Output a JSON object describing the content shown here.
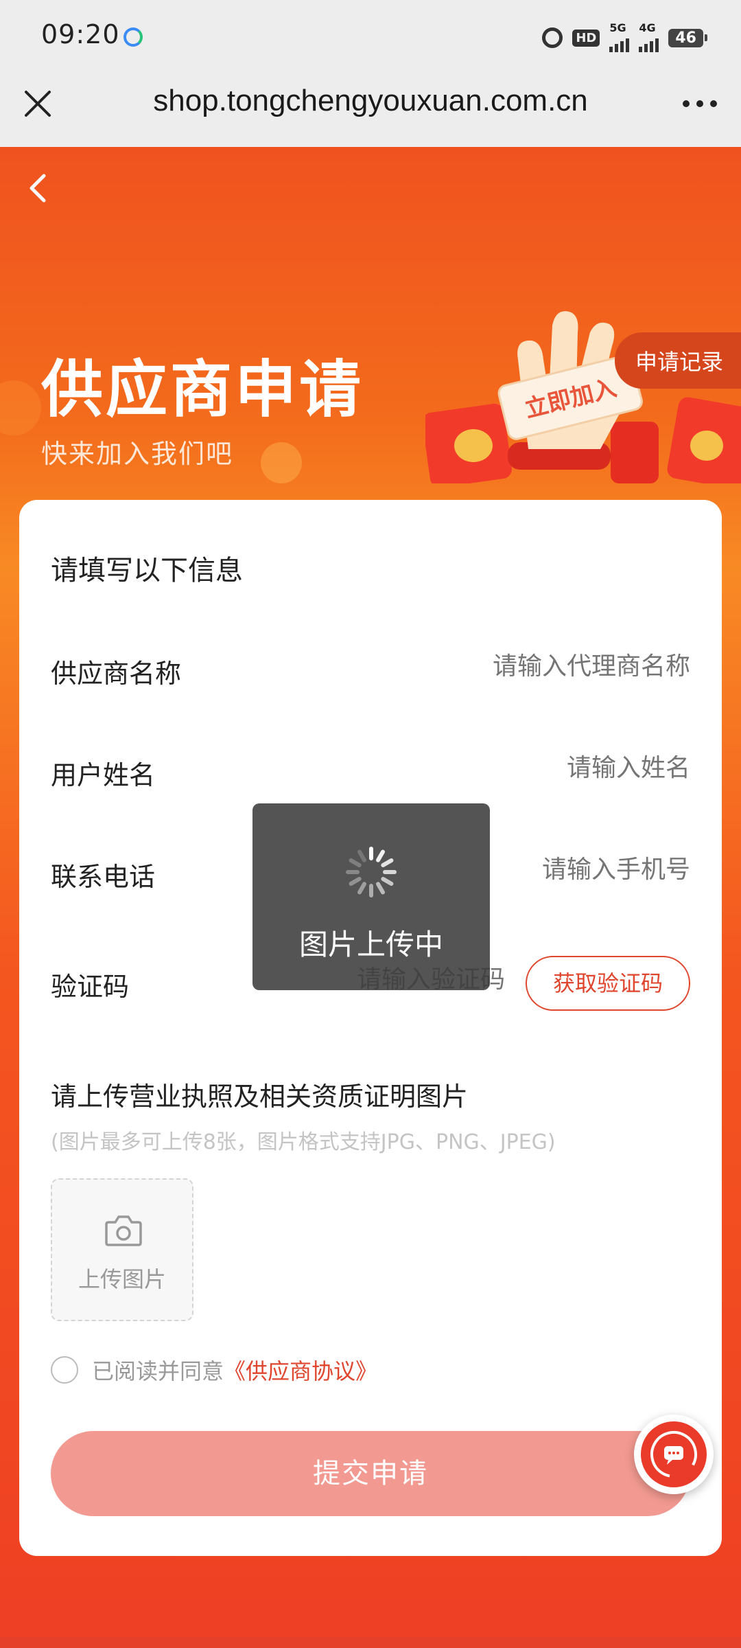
{
  "status_bar": {
    "time": "09:20",
    "hd": "HD",
    "net1": "5G",
    "net2": "4G",
    "battery": "46"
  },
  "browser": {
    "url": "shop.tongchengyouxuan.com.cn"
  },
  "hero": {
    "title": "供应商申请",
    "subtitle": "快来加入我们吧",
    "record_tab": "申请记录",
    "join_card": "立即加入"
  },
  "form": {
    "heading": "请填写以下信息",
    "fields": [
      {
        "label": "供应商名称",
        "placeholder": "请输入代理商名称"
      },
      {
        "label": "用户姓名",
        "placeholder": "请输入姓名"
      },
      {
        "label": "联系电话",
        "placeholder": "请输入手机号"
      },
      {
        "label": "验证码",
        "placeholder": "请输入验证码"
      }
    ],
    "get_code_label": "获取验证码",
    "upload_heading": "请上传营业执照及相关资质证明图片",
    "upload_hint": "(图片最多可上传8张，图片格式支持JPG、PNG、JPEG)",
    "upload_label": "上传图片",
    "agree_text": "已阅读并同意",
    "agree_link": "《供应商协议》",
    "submit_label": "提交申请"
  },
  "toast": {
    "text": "图片上传中"
  },
  "colors": {
    "accent": "#e0452d",
    "submit_bg": "#f29a91",
    "hero_top": "#f0521f"
  }
}
